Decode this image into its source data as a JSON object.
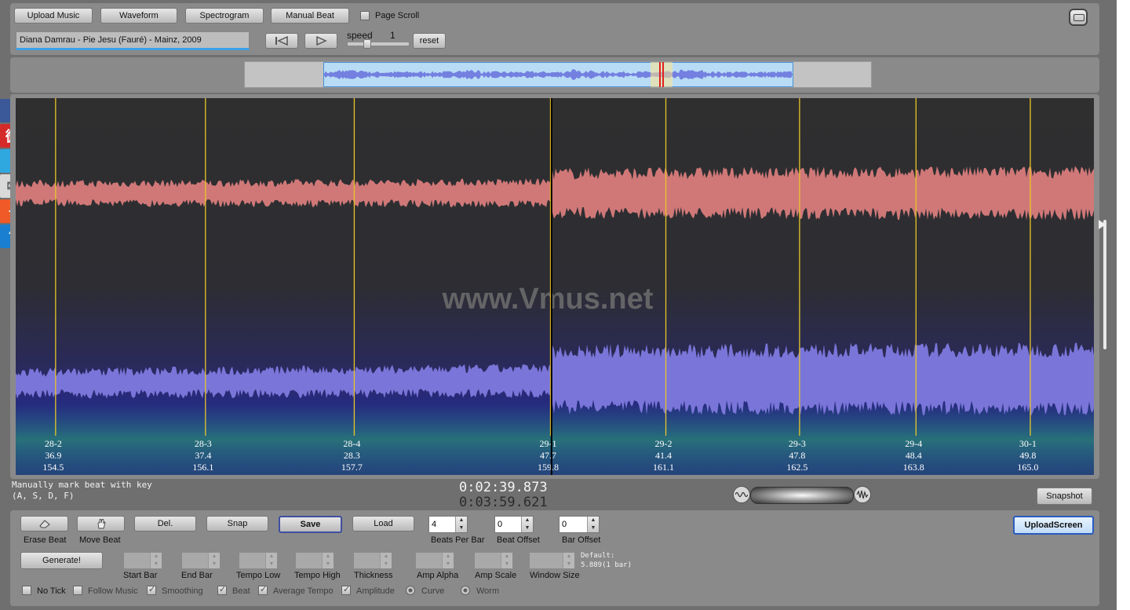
{
  "toolbar": {
    "upload_music": "Upload Music",
    "waveform": "Waveform",
    "spectrogram": "Spectrogram",
    "manual_beat": "Manual Beat",
    "page_scroll": "Page Scroll",
    "track_title": "Diana Damrau - Pie Jesu (Fauré) - Mainz, 2009",
    "speed_label": "speed",
    "speed_value": "1",
    "reset": "reset"
  },
  "overview": {
    "progress_fraction": 0.665
  },
  "viewer": {
    "watermark": "www.Vmus.net",
    "playhead_fraction": 0.497,
    "beats": [
      {
        "label": "28-2",
        "tempo": "36.9",
        "time": "154.5",
        "x": 0.037
      },
      {
        "label": "28-3",
        "tempo": "37.4",
        "time": "156.1",
        "x": 0.176
      },
      {
        "label": "28-4",
        "tempo": "28.3",
        "time": "157.7",
        "x": 0.314
      },
      {
        "label": "29-1",
        "tempo": "47.7",
        "time": "159.8",
        "x": 0.496
      },
      {
        "label": "29-2",
        "tempo": "41.4",
        "time": "161.1",
        "x": 0.603
      },
      {
        "label": "29-3",
        "tempo": "47.8",
        "time": "162.5",
        "x": 0.727
      },
      {
        "label": "29-4",
        "tempo": "48.4",
        "time": "163.8",
        "x": 0.835
      },
      {
        "label": "30-1",
        "tempo": "49.8",
        "time": "165.0",
        "x": 0.941
      }
    ]
  },
  "status": {
    "hint_line1": "Manually mark beat with key",
    "hint_line2": "(A, S, D, F)",
    "current_time": "0:02:39.873",
    "total_time": "0:03:59.621",
    "snapshot": "Snapshot"
  },
  "controls": {
    "erase_beat": "Erase Beat",
    "move_beat": "Move Beat",
    "del": "Del.",
    "snap": "Snap",
    "save": "Save",
    "load": "Load",
    "beats_per_bar_label": "Beats Per Bar",
    "beats_per_bar": "4",
    "beat_offset_label": "Beat Offset",
    "beat_offset": "0",
    "bar_offset_label": "Bar Offset",
    "bar_offset": "0",
    "upload_screen": "UploadScreen",
    "generate": "Generate!",
    "start_bar": "Start Bar",
    "end_bar": "End Bar",
    "tempo_low": "Tempo Low",
    "tempo_high": "Tempo High",
    "thickness": "Thickness",
    "amp_alpha": "Amp Alpha",
    "amp_scale": "Amp Scale",
    "window_size": "Window Size",
    "default_line1": "Default:",
    "default_line2": "5.889(1 bar)",
    "no_tick": "No Tick",
    "follow_music": "Follow Music",
    "smoothing": "Smoothing",
    "beat": "Beat",
    "average_tempo": "Average Tempo",
    "amplitude": "Amplitude",
    "curve": "Curve",
    "worm": "Worm"
  },
  "social": [
    {
      "icon": "facebook-icon",
      "glyph": "f",
      "color": "#3b5998"
    },
    {
      "icon": "weibo-icon",
      "glyph": "微",
      "color": "#d52a2a"
    },
    {
      "icon": "twitter-icon",
      "glyph": "t",
      "color": "#2fa8e0"
    },
    {
      "icon": "mail-icon",
      "glyph": "✉",
      "color": "#d9d9d9"
    },
    {
      "icon": "add-icon",
      "glyph": "+",
      "color": "#f05a28"
    },
    {
      "icon": "help-icon",
      "glyph": "?",
      "color": "#1a7fd0"
    }
  ]
}
